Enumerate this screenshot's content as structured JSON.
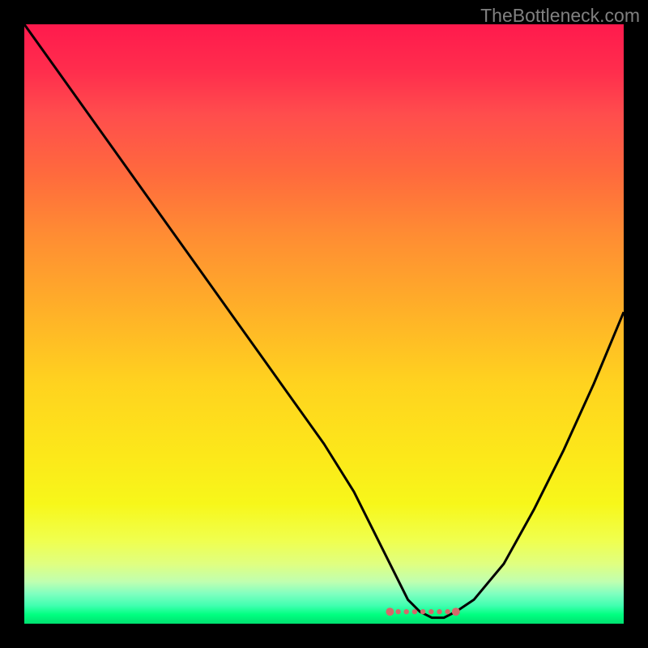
{
  "watermark": "TheBottleneck.com",
  "chart_data": {
    "type": "line",
    "title": "",
    "xlabel": "",
    "ylabel": "",
    "xlim": [
      0,
      100
    ],
    "ylim": [
      0,
      100
    ],
    "series": [
      {
        "name": "bottleneck-curve",
        "x": [
          0,
          5,
          10,
          15,
          20,
          25,
          30,
          35,
          40,
          45,
          50,
          55,
          58,
          60,
          62,
          64,
          66,
          68,
          70,
          72,
          75,
          80,
          85,
          90,
          95,
          100
        ],
        "values": [
          100,
          93,
          86,
          79,
          72,
          65,
          58,
          51,
          44,
          37,
          30,
          22,
          16,
          12,
          8,
          4,
          2,
          1,
          1,
          2,
          4,
          10,
          19,
          29,
          40,
          52
        ]
      }
    ],
    "annotations": [
      {
        "type": "dotted-segment",
        "x_start": 61,
        "x_end": 72,
        "y": 2,
        "color": "#d46a6a"
      }
    ],
    "gradient_stops": [
      {
        "pos": 0,
        "color": "#ff1a4d"
      },
      {
        "pos": 50,
        "color": "#ffd31f"
      },
      {
        "pos": 85,
        "color": "#f7f71a"
      },
      {
        "pos": 100,
        "color": "#00e070"
      }
    ]
  }
}
